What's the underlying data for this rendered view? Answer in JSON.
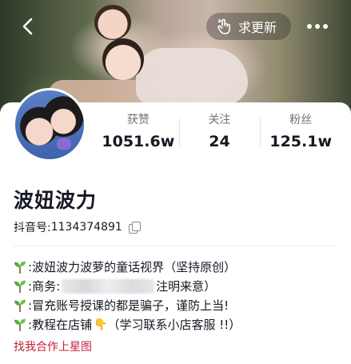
{
  "header": {
    "request_update_label": "求更新"
  },
  "stats": [
    {
      "label": "获赞",
      "value": "1051.6w"
    },
    {
      "label": "关注",
      "value": "24"
    },
    {
      "label": "粉丝",
      "value": "125.1w"
    }
  ],
  "profile": {
    "name": "波妞波力",
    "id_label": "抖音号: ",
    "id_value": "1134374891"
  },
  "bio": {
    "line1_prefix": ": ",
    "line1_text": "波妞波力波萝的童话视界（坚持原创）",
    "line2_prefix": ": ",
    "line2_label": "商务: ",
    "line2_suffix": "注明来意）",
    "line3_prefix": ": ",
    "line3_text": "冒充账号授课的都是骗子，谨防上当!",
    "line4_prefix": ": ",
    "line4_text": "教程在店铺",
    "line4_emoji": "👇",
    "line4_tail": "（学习联系小店客服 !!）"
  },
  "star_link": "找我合作上星图",
  "colors": {
    "link": "#c3223a",
    "muted": "#70727a"
  },
  "icons": [
    "back-icon",
    "finger-icon",
    "more-icon",
    "copy-icon",
    "sprout-icon"
  ]
}
